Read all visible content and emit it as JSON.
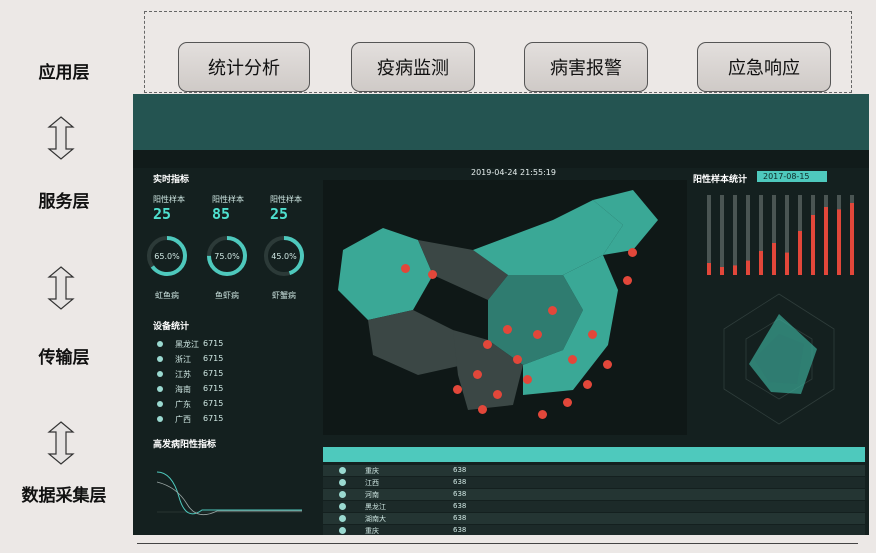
{
  "layers": {
    "application": "应用层",
    "service": "服务层",
    "transport": "传输层",
    "collection": "数据采集层"
  },
  "app_buttons": [
    "统计分析",
    "疫病监测",
    "病害报警",
    "应急响应"
  ],
  "dashboard": {
    "datetime": "2019-04-24 21:55:19",
    "realtime_title": "实时指标",
    "metric_labels": [
      "阳性样本",
      "阳性样本",
      "阳性样本"
    ],
    "metric_values": [
      "25",
      "85",
      "25"
    ],
    "gauges": [
      {
        "pct_text": "65.0%",
        "value": 0.65,
        "label": "虹鱼病"
      },
      {
        "pct_text": "75.0%",
        "value": 0.75,
        "label": "鱼虾病"
      },
      {
        "pct_text": "45.0%",
        "value": 0.45,
        "label": "虾蟹病"
      }
    ],
    "device_title": "设备统计",
    "devices": [
      {
        "name": "黑龙江",
        "count": "6715"
      },
      {
        "name": "浙江",
        "count": "6715"
      },
      {
        "name": "江苏",
        "count": "6715"
      },
      {
        "name": "海南",
        "count": "6715"
      },
      {
        "name": "广东",
        "count": "6715"
      },
      {
        "name": "广西",
        "count": "6715"
      }
    ],
    "high_title": "高发病阳性指标",
    "positive_title": "阳性样本统计",
    "positive_date": "2017-08-15",
    "table_rows": [
      {
        "name": "重庆",
        "val": "638"
      },
      {
        "name": "江西",
        "val": "638"
      },
      {
        "name": "河南",
        "val": "638"
      },
      {
        "name": "黑龙江",
        "val": "638"
      },
      {
        "name": "湖南大",
        "val": "638"
      },
      {
        "name": "重庆",
        "val": "638"
      }
    ],
    "bar_values": [
      0.15,
      0.1,
      0.12,
      0.18,
      0.3,
      0.4,
      0.28,
      0.55,
      0.75,
      0.85,
      0.82,
      0.9
    ]
  },
  "colors": {
    "accent": "#4ec9bd",
    "alert": "#e2473a",
    "teal_land": "#3aa896",
    "dark_land": "#3b4745"
  }
}
